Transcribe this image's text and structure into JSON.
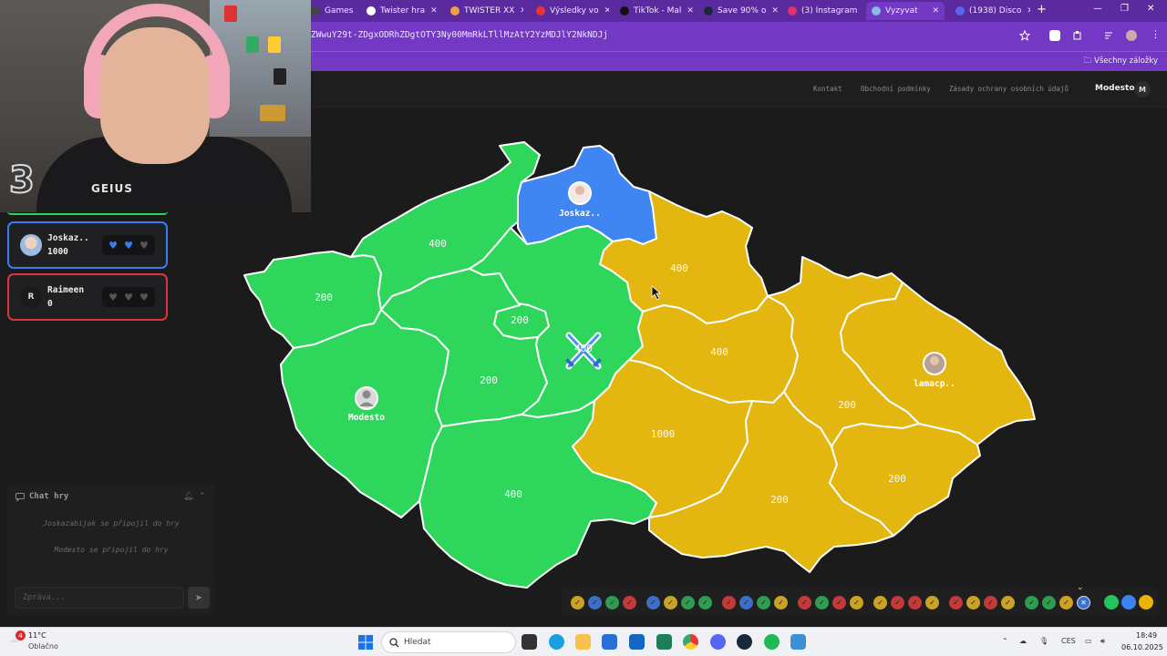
{
  "browser": {
    "tabs": [
      {
        "label": "Games",
        "active": false
      },
      {
        "label": "Twister hra",
        "active": false
      },
      {
        "label": "TWISTER XX",
        "active": false
      },
      {
        "label": "Výsledky vo",
        "active": false
      },
      {
        "label": "TikTok - Mal",
        "active": false
      },
      {
        "label": "Save 90% o",
        "active": false
      },
      {
        "label": "(3) Instagram",
        "active": false
      },
      {
        "label": "Vyzyvat",
        "active": true
      },
      {
        "label": "(1938) Disco",
        "active": false
      }
    ],
    "url": "ZWwuY29t-ZDgxODRhZDgtOTY3Ny00MmRkLTllMzAtY2YzMDJlY2NkNDJj",
    "bookmarks_label": "Všechny záložky",
    "colors": {
      "chrome": "#7339c4",
      "tabstrip": "#5b2a9e"
    }
  },
  "site": {
    "nav": [
      "Kontakt",
      "Obchodní podmínky",
      "Zásady ochrany osobních údajů"
    ],
    "username": "Modesto",
    "avatar_letter": "M"
  },
  "webcam": {
    "jersey_text": "GEIUS",
    "jersey_number": "3"
  },
  "players": [
    {
      "name": "Joskaz..",
      "score": "1000",
      "color": "#3b7df0",
      "hearts": [
        "full",
        "full",
        "empty"
      ]
    },
    {
      "name": "Raimeen",
      "score": "0",
      "color": "#e0323f",
      "avatar_letter": "R",
      "hearts": [
        "empty",
        "empty",
        "empty"
      ]
    }
  ],
  "chat": {
    "title": "Chat hry",
    "messages": [
      "Joskazabijak se připojil do hry",
      "Modesto se připojil do hry"
    ],
    "input_placeholder": "Zpráva..."
  },
  "map": {
    "colors": {
      "green": "#2fd65c",
      "blue": "#3f86f2",
      "gold": "#e3b610"
    },
    "regions": [
      {
        "id": "karlovarsky",
        "owner": "green",
        "value": "200"
      },
      {
        "id": "ustecky",
        "owner": "green",
        "value": "400"
      },
      {
        "id": "liberecky",
        "owner": "blue",
        "value": "",
        "player": "Joskaz.."
      },
      {
        "id": "stredocesky",
        "owner": "green",
        "value": "400",
        "battle": true
      },
      {
        "id": "praha",
        "owner": "green",
        "value": "200"
      },
      {
        "id": "plzensky",
        "owner": "green",
        "value": "",
        "player": "Modesto"
      },
      {
        "id": "jihocesky",
        "owner": "green",
        "value": "400"
      },
      {
        "id": "stredni-zapad",
        "owner": "green",
        "value": "200"
      },
      {
        "id": "kralovehradecky",
        "owner": "gold",
        "value": "400"
      },
      {
        "id": "pardubicky",
        "owner": "gold",
        "value": "400"
      },
      {
        "id": "vysocina",
        "owner": "gold",
        "value": "1000"
      },
      {
        "id": "jihomoravsky",
        "owner": "gold",
        "value": "200"
      },
      {
        "id": "olomoucky",
        "owner": "gold",
        "value": "200"
      },
      {
        "id": "zlinsky",
        "owner": "gold",
        "value": "200"
      },
      {
        "id": "moravskoslezsky",
        "owner": "gold",
        "value": "",
        "player": "lamacp.."
      }
    ]
  },
  "tracker": {
    "rounds": [
      [
        "gold",
        "blue",
        "green",
        "red"
      ],
      [
        "blue",
        "gold",
        "green",
        "green"
      ],
      [
        "red",
        "blue",
        "green",
        "gold"
      ],
      [
        "red",
        "green",
        "red",
        "gold"
      ],
      [
        "gold",
        "red",
        "red",
        "gold"
      ],
      [
        "red",
        "gold",
        "red",
        "gold"
      ],
      [
        "green",
        "green",
        "gold",
        "blue-current"
      ]
    ],
    "players": [
      "green",
      "blue",
      "gold"
    ]
  },
  "taskbar": {
    "weather_badge": "4",
    "temperature": "11°C",
    "weather": "Oblačno",
    "search_placeholder": "Hledat",
    "language": "CES",
    "time": "18:49",
    "date": "06.10.2025"
  }
}
